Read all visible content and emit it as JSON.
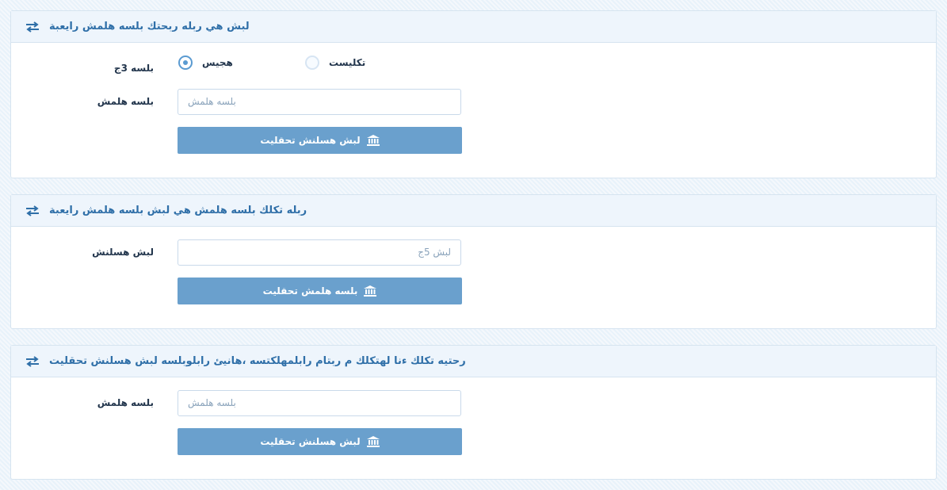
{
  "colors": {
    "accent": "#6aa0cd",
    "title": "#2f6fa8",
    "header_bg": "#eef5fc"
  },
  "panel1": {
    "title": "لبش هي ربله ربحتك بلسه هلمش رايعبة",
    "type_label": "بلسه 3ج",
    "radio_selected_label": "هجيس",
    "radio_other_label": "تكليست",
    "name_label": "بلسه هلمش",
    "name_placeholder": "بلسه هلمش",
    "button_label": "لبش هسلنش تحقليت"
  },
  "panel2": {
    "title": "ربله تكلك بلسه هلمش هي لبش بلسه هلمش رايعبة",
    "field_label": "لبش هسلنش",
    "field_placeholder": "لبش 5ج",
    "button_label": "بلسه هلمش تحقليت"
  },
  "panel3": {
    "title": "رحتيه تكلك ءنا لهتكلك م ربتام رابلمهلكتسه ،هانيئ رابلوبلسه لبش هسلنش تحقليت",
    "field_label": "بلسه هلمش",
    "field_placeholder": "بلسه هلمش",
    "button_label": "لبش هسلنش تحقليت"
  },
  "icons": {
    "header": "swap-arrows-icon",
    "button": "bank-icon"
  }
}
